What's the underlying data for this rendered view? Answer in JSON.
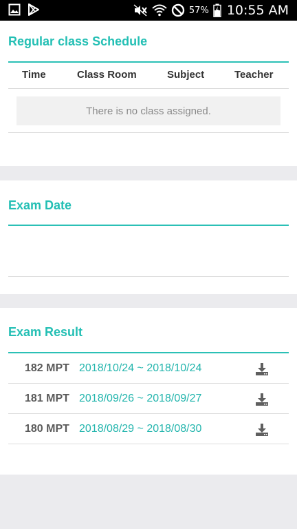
{
  "status_bar": {
    "battery_percent": "57%",
    "time": "10:55 AM",
    "icons": [
      "gallery-icon",
      "play-store-icon",
      "mute-icon",
      "wifi-icon",
      "do-not-disturb-icon",
      "battery-icon"
    ]
  },
  "schedule": {
    "title": "Regular class Schedule",
    "columns": [
      "Time",
      "Class Room",
      "Subject",
      "Teacher"
    ],
    "empty_message": "There is no class assigned."
  },
  "exam_date": {
    "title": "Exam Date"
  },
  "exam_result": {
    "title": "Exam Result",
    "rows": [
      {
        "name": "182 MPT",
        "dates": "2018/10/24 ~ 2018/10/24"
      },
      {
        "name": "181 MPT",
        "dates": "2018/09/26 ~ 2018/09/27"
      },
      {
        "name": "180 MPT",
        "dates": "2018/08/29 ~ 2018/08/30"
      }
    ]
  },
  "colors": {
    "accent": "#23bfb4",
    "background": "#ebebee",
    "divider": "#dcdcdc"
  }
}
